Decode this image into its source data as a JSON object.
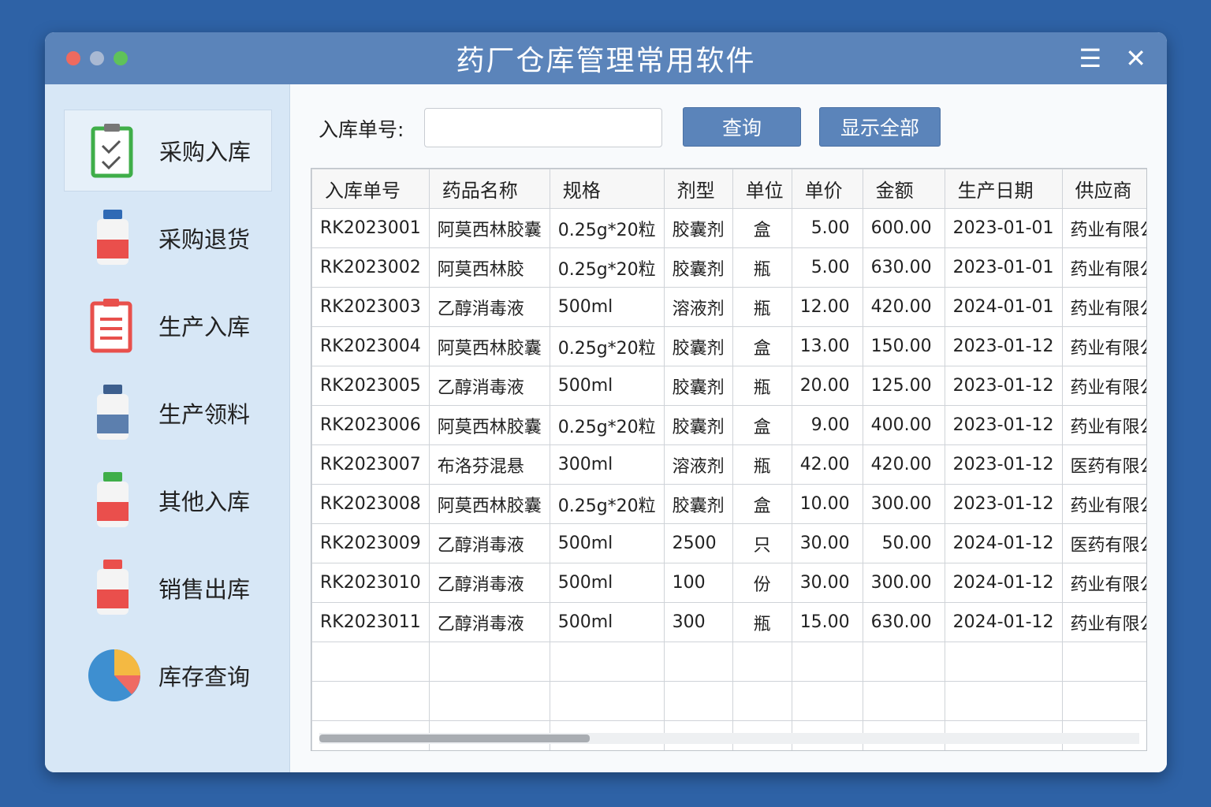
{
  "window": {
    "title": "药厂仓库管理常用软件"
  },
  "sidebar": {
    "items": [
      {
        "label": "采购入库",
        "icon": "clipboard-check-icon",
        "active": true
      },
      {
        "label": "采购退货",
        "icon": "medicine-bottle-icon"
      },
      {
        "label": "生产入库",
        "icon": "clipboard-list-icon"
      },
      {
        "label": "生产领料",
        "icon": "medicine-bottle-icon"
      },
      {
        "label": "其他入库",
        "icon": "medicine-bottle-icon"
      },
      {
        "label": "销售出库",
        "icon": "medicine-bottle-icon"
      },
      {
        "label": "库存查询",
        "icon": "pie-chart-icon"
      }
    ]
  },
  "search": {
    "label": "入库单号:",
    "value": "",
    "query_button": "查询",
    "show_all_button": "显示全部"
  },
  "table": {
    "columns": [
      "入库单号",
      "药品名称",
      "规格",
      "剂型",
      "单位",
      "单价",
      "金额",
      "生产日期",
      "供应商"
    ],
    "rows": [
      [
        "RK2023001",
        "阿莫西林胶囊",
        "0.25g*20粒",
        "胶囊剂",
        "盒",
        "5.00",
        "600.00",
        "2023-01-01",
        "药业有限公司"
      ],
      [
        "RK2023002",
        "阿莫西林胶",
        "0.25g*20粒",
        "胶囊剂",
        "瓶",
        "5.00",
        "630.00",
        "2023-01-01",
        "药业有限公司"
      ],
      [
        "RK2023003",
        "乙醇消毒液",
        "500ml",
        "溶液剂",
        "瓶",
        "12.00",
        "420.00",
        "2024-01-01",
        "药业有限公司"
      ],
      [
        "RK2023004",
        "阿莫西林胶囊",
        "0.25g*20粒",
        "胶囊剂",
        "盒",
        "13.00",
        "150.00",
        "2023-01-12",
        "药业有限公司"
      ],
      [
        "RK2023005",
        "乙醇消毒液",
        "500ml",
        "胶囊剂",
        "瓶",
        "20.00",
        "125.00",
        "2023-01-12",
        "药业有限公司"
      ],
      [
        "RK2023006",
        "阿莫西林胶囊",
        "0.25g*20粒",
        "胶囊剂",
        "盒",
        "9.00",
        "400.00",
        "2023-01-12",
        "药业有限公司"
      ],
      [
        "RK2023007",
        "布洛芬混悬",
        "300ml",
        "溶液剂",
        "瓶",
        "42.00",
        "420.00",
        "2023-01-12",
        "医药有限公司"
      ],
      [
        "RK2023008",
        "阿莫西林胶囊",
        "0.25g*20粒",
        "胶囊剂",
        "盒",
        "10.00",
        "300.00",
        "2023-01-12",
        "药业有限公司"
      ],
      [
        "RK2023009",
        "乙醇消毒液",
        "500ml",
        "2500",
        "只",
        "30.00",
        "50.00",
        "2024-01-12",
        "医药有限公司"
      ],
      [
        "RK2023010",
        "乙醇消毒液",
        "500ml",
        "100",
        "份",
        "30.00",
        "300.00",
        "2024-01-12",
        "药业有限公司"
      ],
      [
        "RK2023011",
        "乙醇消毒液",
        "500ml",
        "300",
        "瓶",
        "15.00",
        "630.00",
        "2024-01-12",
        "药业有限公司"
      ]
    ],
    "scroll_fraction": 0.33
  },
  "colors": {
    "accent": "#5b84ba",
    "sidebar": "#d7e7f6",
    "background": "#2e62a6"
  }
}
